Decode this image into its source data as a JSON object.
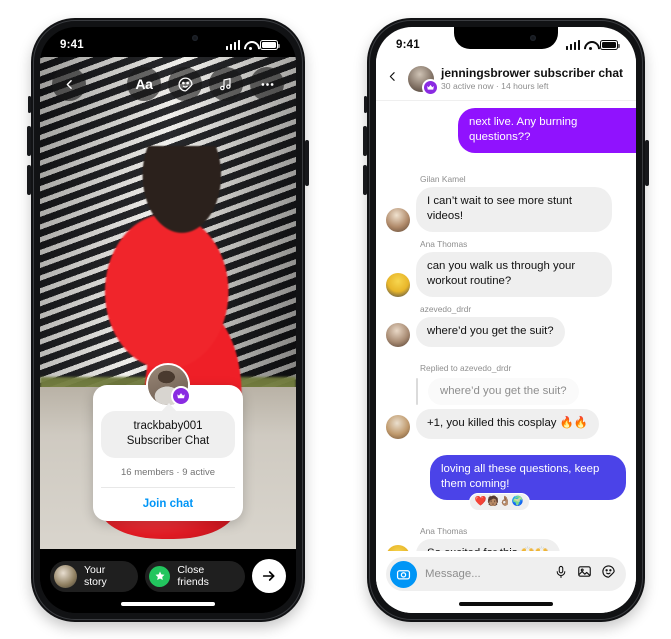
{
  "left_phone": {
    "status_bar": {
      "time": "9:41",
      "signal_icon": "cellular-bars-icon",
      "wifi_icon": "wifi-icon",
      "battery_icon": "battery-icon"
    },
    "story_toolbar": {
      "back_label": "‹",
      "text_tool_label": "Aa",
      "sticker_tool": "sticker-icon",
      "music_tool": "music-note-icon",
      "more_tool": "ellipsis-icon"
    },
    "subscriber_card": {
      "avatar": "creator-avatar",
      "badge_icon": "crown-badge-icon",
      "title_line1": "trackbaby001",
      "title_line2": "Subscriber Chat",
      "meta": "16 members · 9 active",
      "cta": "Join chat",
      "cta_color": "#0095F6"
    },
    "bottom_bar": {
      "your_story_label": "Your story",
      "close_friends_label": "Close friends",
      "close_friends_color": "#22c55e",
      "send_icon": "arrow-right-icon"
    }
  },
  "right_phone": {
    "status_bar": {
      "time": "9:41",
      "signal_icon": "cellular-bars-icon",
      "wifi_icon": "wifi-icon",
      "battery_icon": "battery-icon"
    },
    "header": {
      "back_icon": "back-chevron-icon",
      "avatar": "creator-avatar",
      "badge_icon": "crown-badge-icon",
      "title": "jenningsbrower subscriber chat",
      "subtitle": "30 active now · 14 hours left"
    },
    "messages": [
      {
        "id": "m1",
        "type": "outgoing-purple",
        "text": "next live. Any burning questions??"
      },
      {
        "id": "m2",
        "type": "incoming",
        "sender": "Gilan Kamel",
        "text": "I can’t wait to see more stunt videos!"
      },
      {
        "id": "m3",
        "type": "incoming",
        "sender": "Ana Thomas",
        "text": "can you walk us through your workout routine?"
      },
      {
        "id": "m4",
        "type": "incoming",
        "sender": "azevedo_drdr",
        "text": "where’d you get the suit?"
      },
      {
        "id": "m5",
        "type": "reply",
        "reply_label": "Replied to azevedo_drdr",
        "quote": "where’d you get the suit?",
        "text": "+1, you killed this cosplay 🔥🔥"
      },
      {
        "id": "m6",
        "type": "outgoing-blue",
        "text": "loving all these questions, keep them coming!",
        "reactions": "❤️🧑🏽👌🏽🌍"
      },
      {
        "id": "m7",
        "type": "incoming",
        "sender": "Ana Thomas",
        "text": "So excited for this 🙌🙌"
      }
    ],
    "input_bar": {
      "camera_icon": "camera-icon",
      "placeholder": "Message...",
      "mic_icon": "microphone-icon",
      "photo_icon": "photo-icon",
      "sticker_icon": "sticker-icon"
    }
  },
  "colors": {
    "purple_bubble": "#9012FE",
    "blue_bubble": "#4B43E8",
    "incoming_bubble": "#efefef",
    "link_blue": "#0095F6",
    "badge_purple": "#8A2BE2"
  }
}
